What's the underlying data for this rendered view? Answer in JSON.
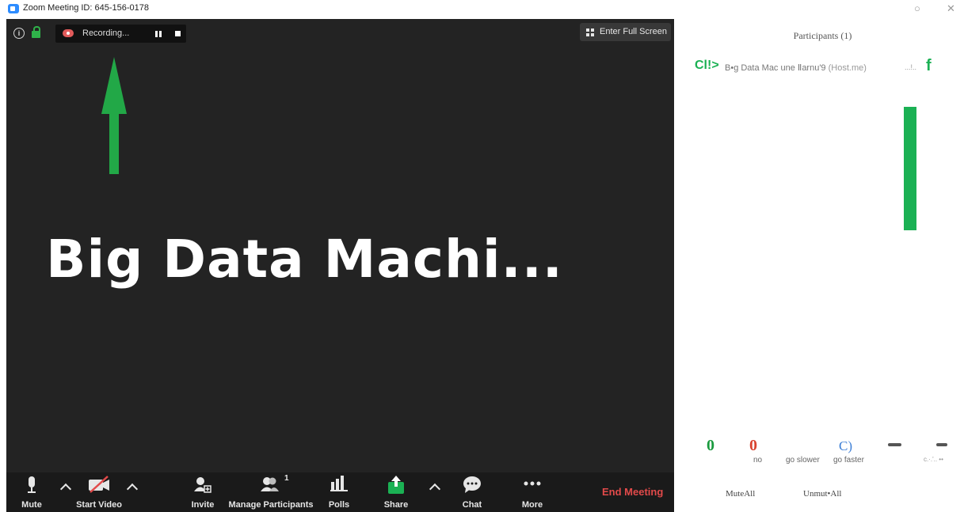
{
  "window": {
    "title": "Zoom Meeting ID: 645-156-0178",
    "minimize_glyph": "○",
    "close_glyph": "✕"
  },
  "meeting": {
    "recording_label": "Recording...",
    "fullscreen_label": "Enter Full Screen",
    "shared_title": "Big Data Machi...",
    "accent_green": "#2fb34a",
    "end_meeting_color": "#e24a4a"
  },
  "toolbar": {
    "mute": "Mute",
    "start_video": "Start Video",
    "invite": "Invite",
    "manage_participants": "Manage Participants",
    "participants_count": "1",
    "polls": "Polls",
    "share": "Share",
    "chat": "Chat",
    "more": "More",
    "end_meeting": "End Meeting"
  },
  "participants_panel": {
    "title": "Participants (1)",
    "participant": {
      "avatar_text": "Cl!>",
      "name": "B•g Data Mac une Ⅱarnu'9",
      "role": "(Host.me)",
      "status_dots": "...!..",
      "badge": "f"
    },
    "feedback": {
      "yes_icon": "0",
      "no_icon": "0",
      "no_label": "no",
      "slower_label": "go slower",
      "faster_icon": "C)",
      "faster_label": "go faster",
      "more_label": "c.·.'.. ••"
    },
    "mute_all": "MuteAll",
    "unmute_all": "Unmut•All"
  }
}
